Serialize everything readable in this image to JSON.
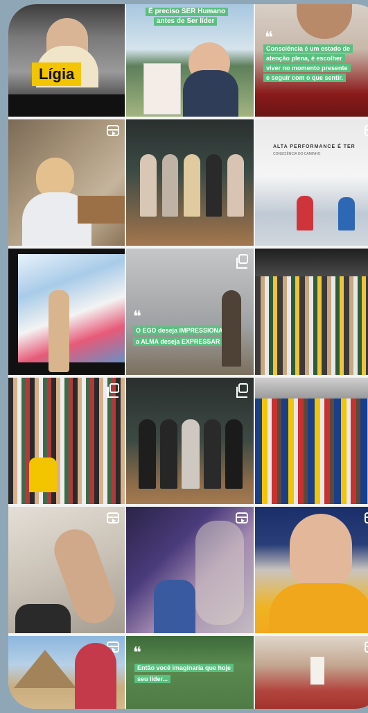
{
  "tiles": [
    {
      "id": "t1",
      "label": "Lígia",
      "type": "photo"
    },
    {
      "id": "t2",
      "caption_lines": [
        "É preciso SER Humano",
        "antes de Ser líder"
      ],
      "type": "photo"
    },
    {
      "id": "t3",
      "caption_lines": [
        "Consciência é um estado de",
        "atenção plena, é escolher",
        "viver no momento presente",
        "e seguir com o que sentir."
      ],
      "type": "photo"
    },
    {
      "id": "t4",
      "type": "reel"
    },
    {
      "id": "t5",
      "type": "photo"
    },
    {
      "id": "t6",
      "caption_lines": [
        "ALTA PERFORMANCE É TER",
        "CONSCIÊNCIA DO CAMINHO"
      ],
      "type": "reel"
    },
    {
      "id": "t7",
      "type": "photo"
    },
    {
      "id": "t8",
      "caption_lines": [
        "O EGO deseja IMPRESSIONAR",
        "a ALMA deseja EXPRESSAR"
      ],
      "type": "multi"
    },
    {
      "id": "t9",
      "type": "photo"
    },
    {
      "id": "t10",
      "type": "multi"
    },
    {
      "id": "t11",
      "type": "multi"
    },
    {
      "id": "t12",
      "type": "multi"
    },
    {
      "id": "t13",
      "type": "reel"
    },
    {
      "id": "t14",
      "type": "reel"
    },
    {
      "id": "t15",
      "type": "reel"
    },
    {
      "id": "t16",
      "type": "reel"
    },
    {
      "id": "t17",
      "caption_lines": [
        "Então você imaginaria que hoje",
        "seu líder..."
      ],
      "type": "photo"
    },
    {
      "id": "t18",
      "type": "reel"
    }
  ],
  "colors": {
    "caption_green": "#59c07f",
    "tag_yellow": "#f2c500"
  }
}
